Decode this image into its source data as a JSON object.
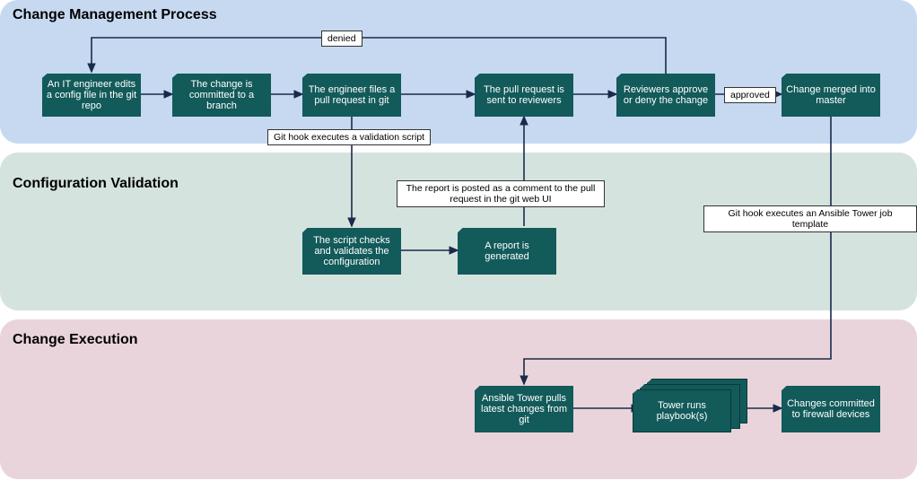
{
  "lanes": {
    "change_mgmt": {
      "title": "Change Management Process"
    },
    "config_val": {
      "title": "Configuration Validation"
    },
    "change_exec": {
      "title": "Change Execution"
    }
  },
  "nodes": {
    "a1": "An IT engineer edits a config file in the git repo",
    "a2": "The change is committed to a branch",
    "a3": "The engineer files a pull request in git",
    "a4": "The pull request is sent to reviewers",
    "a5": "Reviewers approve or deny the change",
    "a6": "Change merged into master",
    "b1": "The script checks and validates the configuration",
    "b2": "A report is generated",
    "c1": "Ansible Tower pulls latest changes from git",
    "c2": "Tower runs playbook(s)",
    "c3": "Changes committed to firewall devices"
  },
  "labels": {
    "denied": "denied",
    "approved": "approved",
    "hook_validate": "Git hook executes a validation script",
    "report_comment": "The report is posted as a comment to the pull request in the git web UI",
    "hook_ansible": "Git hook executes an Ansible Tower job template"
  },
  "colors": {
    "lane1": "#c6d9f1",
    "lane2": "#d5e3df",
    "lane3": "#e9d4db",
    "node": "#135a5a",
    "arrow": "#1a2a4a"
  }
}
